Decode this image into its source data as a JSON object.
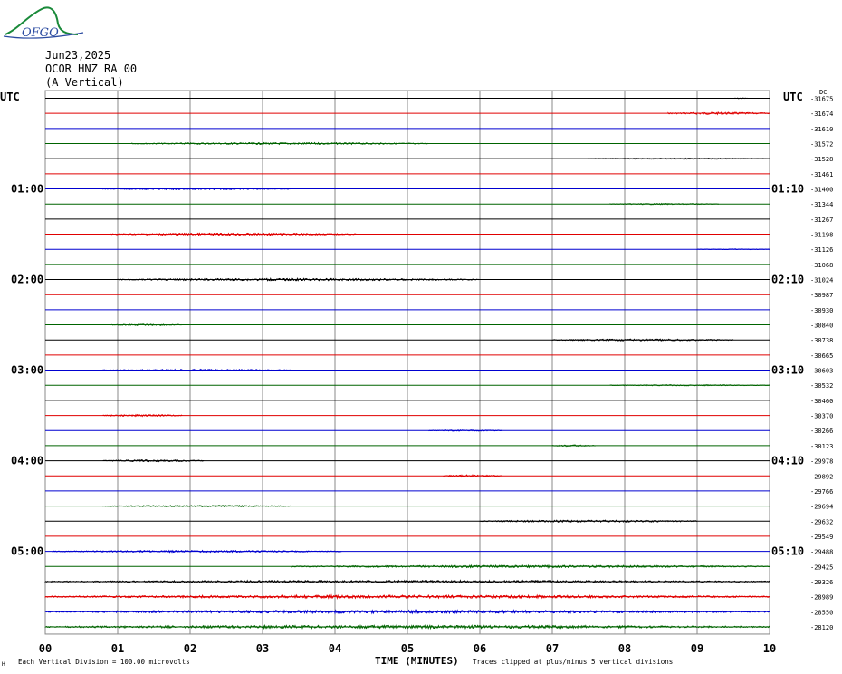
{
  "header": {
    "date": "Jun23,2025",
    "station": "OCOR HNZ RA 00",
    "component": "(A Vertical)",
    "logo_text": "OFGO"
  },
  "axis_labels": {
    "utc_left": "UTC",
    "utc_right": "UTC",
    "dc_label": "DC",
    "xlabel": "TIME (MINUTES)"
  },
  "footer": {
    "scale_note": "Each Vertical Division =  100.00 microvolts",
    "clip_note": "Traces clipped at plus/minus 5 vertical divisions",
    "corner_mark": "H"
  },
  "colors": {
    "trace_cycle": [
      "#000000",
      "#e00000",
      "#0000d0",
      "#006400"
    ],
    "grid": "#888888",
    "logo": "#1a8a3a"
  },
  "chart_data": {
    "type": "line",
    "title": "",
    "xlabel": "TIME (MINUTES)",
    "ylabel": "",
    "xlim": [
      0,
      10
    ],
    "x_ticks": [
      "00",
      "01",
      "02",
      "03",
      "04",
      "05",
      "06",
      "07",
      "08",
      "09",
      "10"
    ],
    "time_labels_left": [
      {
        "row": 6,
        "label": "01:00"
      },
      {
        "row": 12,
        "label": "02:00"
      },
      {
        "row": 18,
        "label": "03:00"
      },
      {
        "row": 24,
        "label": "04:00"
      },
      {
        "row": 30,
        "label": "05:00"
      }
    ],
    "time_labels_right": [
      {
        "row": 6,
        "label": "01:10"
      },
      {
        "row": 12,
        "label": "02:10"
      },
      {
        "row": 18,
        "label": "03:10"
      },
      {
        "row": 24,
        "label": "04:10"
      },
      {
        "row": 30,
        "label": "05:10"
      }
    ],
    "dc_offsets": [
      "-31675",
      "-31674",
      "-31610",
      "-31572",
      "-31528",
      "-31461",
      "-31400",
      "-31344",
      "-31267",
      "-31198",
      "-31126",
      "-31068",
      "-31024",
      "-30987",
      "-30930",
      "-30840",
      "-30738",
      "-30665",
      "-30603",
      "-30532",
      "-30460",
      "-30370",
      "-30266",
      "-30123",
      "-29978",
      "-29892",
      "-29766",
      "-29694",
      "-29632",
      "-29549",
      "-29488",
      "-29425",
      "-29326",
      "-28989",
      "-28550",
      "-28120"
    ],
    "noise_segments": [
      {
        "row": 0,
        "start": 9.5,
        "end": 9.7,
        "amp": 0.4
      },
      {
        "row": 1,
        "start": 8.6,
        "end": 10.0,
        "amp": 1.2
      },
      {
        "row": 3,
        "start": 1.2,
        "end": 5.3,
        "amp": 1.0
      },
      {
        "row": 4,
        "start": 7.5,
        "end": 10.0,
        "amp": 0.6
      },
      {
        "row": 6,
        "start": 0.8,
        "end": 3.4,
        "amp": 0.9
      },
      {
        "row": 7,
        "start": 7.8,
        "end": 9.3,
        "amp": 0.6
      },
      {
        "row": 9,
        "start": 0.9,
        "end": 4.3,
        "amp": 1.1
      },
      {
        "row": 10,
        "start": 9.0,
        "end": 10.0,
        "amp": 0.4
      },
      {
        "row": 12,
        "start": 1.0,
        "end": 6.0,
        "amp": 1.2
      },
      {
        "row": 15,
        "start": 0.9,
        "end": 1.9,
        "amp": 0.8
      },
      {
        "row": 16,
        "start": 7.0,
        "end": 9.5,
        "amp": 1.0
      },
      {
        "row": 18,
        "start": 0.8,
        "end": 3.4,
        "amp": 1.0
      },
      {
        "row": 19,
        "start": 7.8,
        "end": 10.0,
        "amp": 0.6
      },
      {
        "row": 21,
        "start": 0.8,
        "end": 1.9,
        "amp": 1.0
      },
      {
        "row": 22,
        "start": 5.3,
        "end": 6.3,
        "amp": 0.7
      },
      {
        "row": 23,
        "start": 7.0,
        "end": 7.6,
        "amp": 0.8
      },
      {
        "row": 24,
        "start": 0.8,
        "end": 2.2,
        "amp": 1.0
      },
      {
        "row": 25,
        "start": 5.5,
        "end": 6.3,
        "amp": 1.1
      },
      {
        "row": 27,
        "start": 0.8,
        "end": 3.4,
        "amp": 0.8
      },
      {
        "row": 28,
        "start": 6.0,
        "end": 9.0,
        "amp": 1.1
      },
      {
        "row": 30,
        "start": 0.1,
        "end": 4.1,
        "amp": 1.0
      },
      {
        "row": 31,
        "start": 3.4,
        "end": 10.0,
        "amp": 1.2
      },
      {
        "row": 32,
        "start": 0.0,
        "end": 10.0,
        "amp": 1.3
      },
      {
        "row": 33,
        "start": 0.0,
        "end": 10.0,
        "amp": 1.6
      },
      {
        "row": 34,
        "start": 0.0,
        "end": 10.0,
        "amp": 1.6
      },
      {
        "row": 35,
        "start": 0.0,
        "end": 10.0,
        "amp": 1.6
      }
    ]
  }
}
